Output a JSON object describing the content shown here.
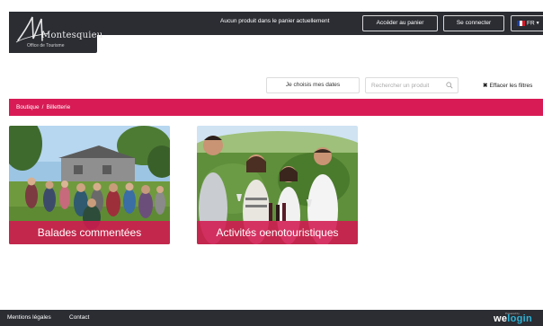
{
  "header": {
    "logo": {
      "name": "Montesquieu",
      "subtitle": "Office de Tourisme"
    },
    "cart_message": "Aucun produit dans le panier actuellement",
    "cart_button": "Accéder au panier",
    "login_button": "Se connecter",
    "language": "FR",
    "icons": [
      "france-flag-icon",
      "chevron-down-icon"
    ]
  },
  "filters": {
    "dates_button": "Je choisis mes dates",
    "search_placeholder": "Rechercher un produit",
    "clear_label": "Effacer les filtres",
    "clear_icon": "✖"
  },
  "breadcrumb": {
    "items": [
      "Boutique",
      "Billetterie"
    ],
    "separator": "/"
  },
  "cards": [
    {
      "title": "Balades commentées",
      "image": "group-walk-photo"
    },
    {
      "title": "Activités oenotouristiques",
      "image": "wine-tasting-photo"
    }
  ],
  "footer": {
    "links": [
      "Mentions légales",
      "Contact"
    ],
    "powered_by": "Powered by",
    "brand": {
      "part1": "we",
      "part2": "login"
    }
  },
  "colors": {
    "dark": "#2b2d33",
    "accent": "#d81b55",
    "brand_blue": "#2fb4d6"
  }
}
